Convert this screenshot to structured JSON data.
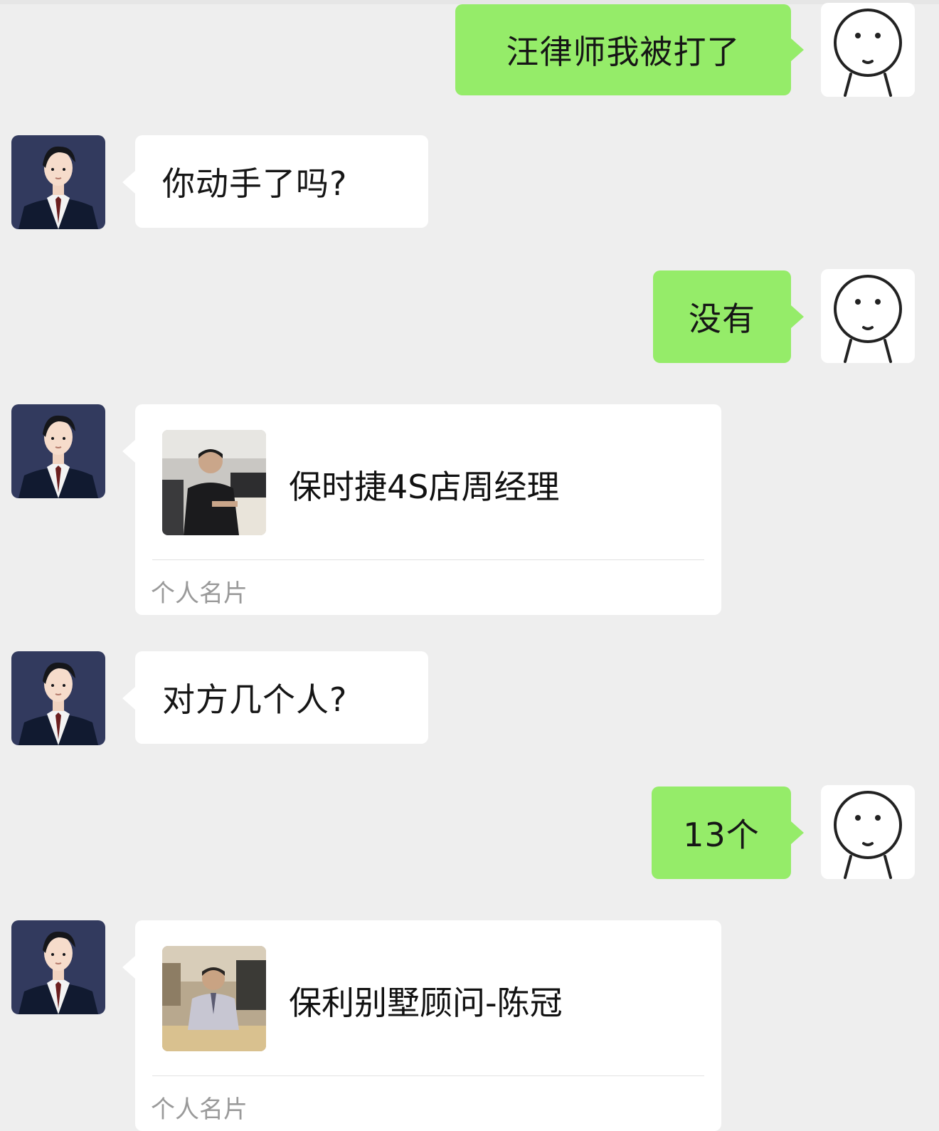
{
  "messages": [
    {
      "from": "me",
      "text": "汪律师我被打了"
    },
    {
      "from": "lawyer",
      "text": "你动手了吗?"
    },
    {
      "from": "me",
      "text": "没有"
    },
    {
      "from": "lawyer",
      "type": "contact-card",
      "name": "保时捷4S店周经理",
      "label": "个人名片"
    },
    {
      "from": "lawyer",
      "text": "对方几个人?"
    },
    {
      "from": "me",
      "text": "13个"
    },
    {
      "from": "lawyer",
      "type": "contact-card",
      "name": "保利别墅顾问-陈冠",
      "label": "个人名片"
    }
  ],
  "colors": {
    "my_bubble": "#95ec69",
    "their_bubble": "#ffffff",
    "background": "#eeeeee"
  },
  "icons": {
    "my_avatar": "doodle-face-icon",
    "lawyer_avatar": "lawyer-cartoon-icon"
  }
}
